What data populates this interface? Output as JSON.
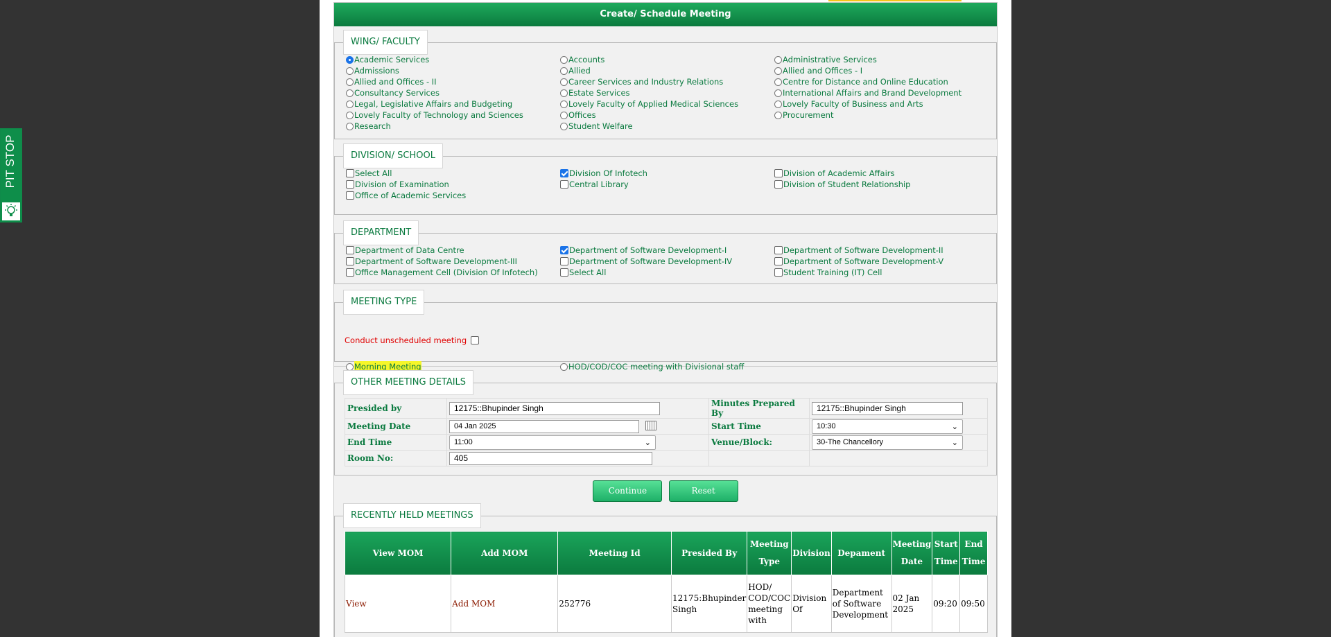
{
  "side_tab": {
    "label": "PIT STOP"
  },
  "header": {
    "title": "Create/ Schedule Meeting"
  },
  "wing": {
    "legend": "WING/ FACULTY",
    "options": [
      {
        "label": "Academic Services",
        "selected": true
      },
      {
        "label": "Accounts",
        "selected": false
      },
      {
        "label": "Administrative Services",
        "selected": false
      },
      {
        "label": "Admissions",
        "selected": false
      },
      {
        "label": "Allied",
        "selected": false
      },
      {
        "label": "Allied and Offices - I",
        "selected": false
      },
      {
        "label": "Allied and Offices - II",
        "selected": false
      },
      {
        "label": "Career Services and Industry Relations",
        "selected": false
      },
      {
        "label": "Centre for Distance and Online Education",
        "selected": false
      },
      {
        "label": "Consultancy Services",
        "selected": false
      },
      {
        "label": "Estate Services",
        "selected": false
      },
      {
        "label": "International Affairs and Brand Development",
        "selected": false
      },
      {
        "label": "Legal, Legislative Affairs and Budgeting",
        "selected": false
      },
      {
        "label": "Lovely Faculty of Applied Medical Sciences",
        "selected": false
      },
      {
        "label": "Lovely Faculty of Business and Arts",
        "selected": false
      },
      {
        "label": "Lovely Faculty of Technology and Sciences",
        "selected": false
      },
      {
        "label": "Offices",
        "selected": false
      },
      {
        "label": "Procurement",
        "selected": false
      },
      {
        "label": "Research",
        "selected": false
      },
      {
        "label": "Student Welfare",
        "selected": false
      }
    ]
  },
  "division": {
    "legend": "DIVISION/ SCHOOL",
    "options": [
      {
        "label": "Select All",
        "checked": false
      },
      {
        "label": "Division Of Infotech",
        "checked": true
      },
      {
        "label": "Division of Academic Affairs",
        "checked": false
      },
      {
        "label": "Division of Examination",
        "checked": false
      },
      {
        "label": "Central Library",
        "checked": false
      },
      {
        "label": "Division of Student Relationship",
        "checked": false
      },
      {
        "label": "Office of Academic Services",
        "checked": false
      }
    ]
  },
  "department": {
    "legend": "DEPARTMENT",
    "options": [
      {
        "label": "Department of Data Centre",
        "checked": false
      },
      {
        "label": "Department of Software Development-I",
        "checked": true
      },
      {
        "label": "Department of Software Development-II",
        "checked": false
      },
      {
        "label": "Department of Software Development-III",
        "checked": false
      },
      {
        "label": "Department of Software Development-IV",
        "checked": false
      },
      {
        "label": "Department of Software Development-V",
        "checked": false
      },
      {
        "label": "Office Management Cell (Division Of Infotech)",
        "checked": false
      },
      {
        "label": "Select All",
        "checked": false
      },
      {
        "label": "Student Training (IT) Cell",
        "checked": false
      }
    ]
  },
  "meeting_type": {
    "legend": "MEETING TYPE",
    "unscheduled_label": "Conduct unscheduled meeting",
    "morning": "Morning Meeting",
    "hod": "HOD/COD/COC meeting with Divisional staff"
  },
  "details": {
    "legend": "OTHER MEETING DETAILS",
    "presided_label": "Presided by",
    "presided_value": "12175::Bhupinder Singh",
    "minutes_label": "Minutes Prepared By",
    "minutes_value": "12175::Bhupinder Singh",
    "date_label": "Meeting Date",
    "date_value": "04 Jan 2025",
    "start_label": "Start Time",
    "start_value": "10:30",
    "end_label": "End Time",
    "end_value": "11:00",
    "venue_label": "Venue/Block:",
    "venue_value": "30-The Chancellory",
    "room_label": "Room No:",
    "room_value": "405"
  },
  "buttons": {
    "continue": "Continue",
    "reset": "Reset"
  },
  "recent": {
    "legend": "RECENTLY HELD MEETINGS",
    "headers": [
      "View MOM",
      "Add MOM",
      "Meeting Id",
      "Presided By",
      "Meeting Type",
      "Division",
      "Depament",
      "Meeting Date",
      "Start Time",
      "End Time"
    ],
    "rows": [
      {
        "view": "View",
        "add": "Add MOM",
        "id": "252776",
        "presided": "12175:Bhupinder Singh",
        "type": "HOD/ COD/COC meeting with",
        "division": "Division Of",
        "dept": "Department of Software Development",
        "date": "02 Jan 2025",
        "start": "09:20",
        "end": "09:50"
      }
    ]
  }
}
